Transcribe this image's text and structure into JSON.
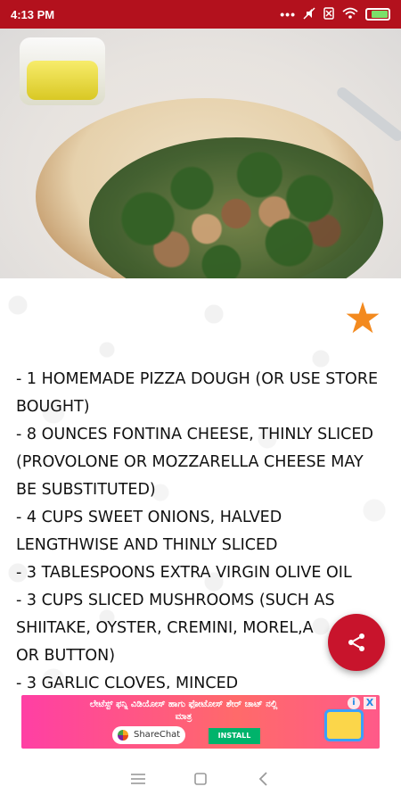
{
  "status_bar": {
    "time": "4:13 PM",
    "icons": [
      "overflow-dots-icon",
      "mute-icon",
      "sim-icon",
      "wifi-icon",
      "battery-icon"
    ]
  },
  "recipe": {
    "favorite_icon": "star-icon",
    "ingredients": [
      "- 1 homemade pizza dough (or use store bought)",
      "- 8 ounces fontina cheese, thinly sliced (provolone or mozzarella cheese may be substituted)",
      "- 4 cups sweet onions, halved lengthwise and thinly sliced",
      "- 3 tablespoons extra virgin olive oil",
      "- 3 cups sliced mushrooms (such as shiitake, oyster, cremini, morel,a",
      "or button)",
      "- 3 garlic cloves, minced"
    ],
    "share_icon": "share-icon"
  },
  "ad": {
    "headline": "ಲೇಟೆಸ್ಟ್ ಫನ್ನಿ ವಿಡಿಯೋಸ್ ಹಾಗು ಫೋಟೋಸ್ ಶೇರ್ ಚಾಟ್ ನಲ್ಲಿ ಮಾತ್ರ",
    "brand": "ShareChat",
    "cta": "INSTALL NOW",
    "info_icon": "i",
    "close_icon": "X"
  },
  "colors": {
    "status_bar": "#b3111d",
    "fab": "#c8142c",
    "star": "#f38a1f",
    "ad_gradient_start": "#ff3fa4"
  },
  "nav": {
    "icons": [
      "menu-icon",
      "home-square-icon",
      "back-icon"
    ]
  }
}
